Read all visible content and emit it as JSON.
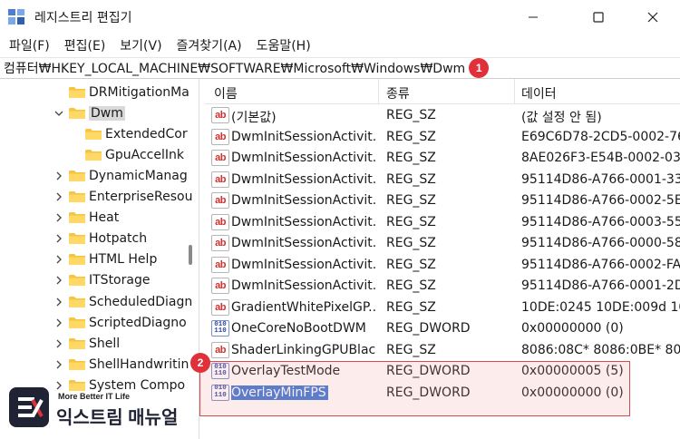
{
  "window": {
    "title": "레지스트리 편집기",
    "minimize_icon": "minimize-icon",
    "maximize_icon": "maximize-icon",
    "close_icon": "close-icon"
  },
  "menu": [
    "파일(F)",
    "편집(E)",
    "보기(V)",
    "즐겨찾기(A)",
    "도움말(H)"
  ],
  "address": {
    "path": "컴퓨터₩HKEY_LOCAL_MACHINE₩SOFTWARE₩Microsoft₩Windows₩Dwm",
    "badge": "1"
  },
  "tree": [
    {
      "label": "DRMitigationMa",
      "level": 1,
      "chevron": "",
      "state": "normal"
    },
    {
      "label": "Dwm",
      "level": 1,
      "chevron": "expanded",
      "state": "selected"
    },
    {
      "label": "ExtendedCor",
      "level": 2,
      "chevron": "",
      "state": "normal"
    },
    {
      "label": "GpuAccelInk",
      "level": 2,
      "chevron": "",
      "state": "normal"
    },
    {
      "label": "DynamicManag",
      "level": 1,
      "chevron": "collapsed",
      "state": "normal"
    },
    {
      "label": "EnterpriseResou",
      "level": 1,
      "chevron": "collapsed",
      "state": "normal"
    },
    {
      "label": "Heat",
      "level": 1,
      "chevron": "collapsed",
      "state": "normal"
    },
    {
      "label": "Hotpatch",
      "level": 1,
      "chevron": "collapsed",
      "state": "normal"
    },
    {
      "label": "HTML Help",
      "level": 1,
      "chevron": "collapsed",
      "state": "normal"
    },
    {
      "label": "ITStorage",
      "level": 1,
      "chevron": "collapsed",
      "state": "normal"
    },
    {
      "label": "ScheduledDiagn",
      "level": 1,
      "chevron": "collapsed",
      "state": "normal"
    },
    {
      "label": "ScriptedDiagno",
      "level": 1,
      "chevron": "collapsed",
      "state": "normal"
    },
    {
      "label": "Shell",
      "level": 1,
      "chevron": "collapsed",
      "state": "normal"
    },
    {
      "label": "ShellHandwritin",
      "level": 1,
      "chevron": "collapsed",
      "state": "normal"
    },
    {
      "label": "System Compo",
      "level": 1,
      "chevron": "collapsed",
      "state": "normal"
    }
  ],
  "list": {
    "headers": {
      "name": "이름",
      "type": "종류",
      "data": "데이터"
    },
    "rows": [
      {
        "name": "(기본값)",
        "type": "REG_SZ",
        "data": "(값 설정 안 됨)",
        "icon": "string-value-icon",
        "selected": false
      },
      {
        "name": "DwmInitSessionActivit...",
        "type": "REG_SZ",
        "data": "E69C6D78-2CD5-0002-76",
        "icon": "string-value-icon",
        "selected": false
      },
      {
        "name": "DwmInitSessionActivit...",
        "type": "REG_SZ",
        "data": "8AE026F3-E54B-0002-03C",
        "icon": "string-value-icon",
        "selected": false
      },
      {
        "name": "DwmInitSessionActivit...",
        "type": "REG_SZ",
        "data": "95114D86-A766-0001-338",
        "icon": "string-value-icon",
        "selected": false
      },
      {
        "name": "DwmInitSessionActivit...",
        "type": "REG_SZ",
        "data": "95114D86-A766-0002-5E0",
        "icon": "string-value-icon",
        "selected": false
      },
      {
        "name": "DwmInitSessionActivit...",
        "type": "REG_SZ",
        "data": "95114D86-A766-0003-559",
        "icon": "string-value-icon",
        "selected": false
      },
      {
        "name": "DwmInitSessionActivit...",
        "type": "REG_SZ",
        "data": "95114D86-A766-0000-58B",
        "icon": "string-value-icon",
        "selected": false
      },
      {
        "name": "DwmInitSessionActivit...",
        "type": "REG_SZ",
        "data": "95114D86-A766-0002-FA2",
        "icon": "string-value-icon",
        "selected": false
      },
      {
        "name": "DwmInitSessionActivit...",
        "type": "REG_SZ",
        "data": "95114D86-A766-0001-2D0",
        "icon": "string-value-icon",
        "selected": false
      },
      {
        "name": "GradientWhitePixelGP...",
        "type": "REG_SZ",
        "data": "10DE:0245 10DE:009d 10D",
        "icon": "string-value-icon",
        "selected": false
      },
      {
        "name": "OneCoreNoBootDWM",
        "type": "REG_DWORD",
        "data": "0x00000000 (0)",
        "icon": "dword-value-icon",
        "selected": false
      },
      {
        "name": "ShaderLinkingGPUBlac...",
        "type": "REG_SZ",
        "data": "8086:08C* 8086:0BE* 8086",
        "icon": "string-value-icon",
        "selected": false
      },
      {
        "name": "OverlayTestMode",
        "type": "REG_DWORD",
        "data": "0x00000005 (5)",
        "icon": "dword-value-icon",
        "selected": false
      },
      {
        "name": "OverlayMinFPS",
        "type": "REG_DWORD",
        "data": "0x00000000 (0)",
        "icon": "dword-value-icon",
        "selected": true
      }
    ],
    "badge": "2"
  },
  "watermark": {
    "tagline": "More Better IT Life",
    "name": "익스트림 매뉴얼"
  },
  "colors": {
    "badge": "#e0303a",
    "highlight_border": "#d74a4f",
    "selection": "#3b78d8",
    "folder": "#f5c542"
  }
}
